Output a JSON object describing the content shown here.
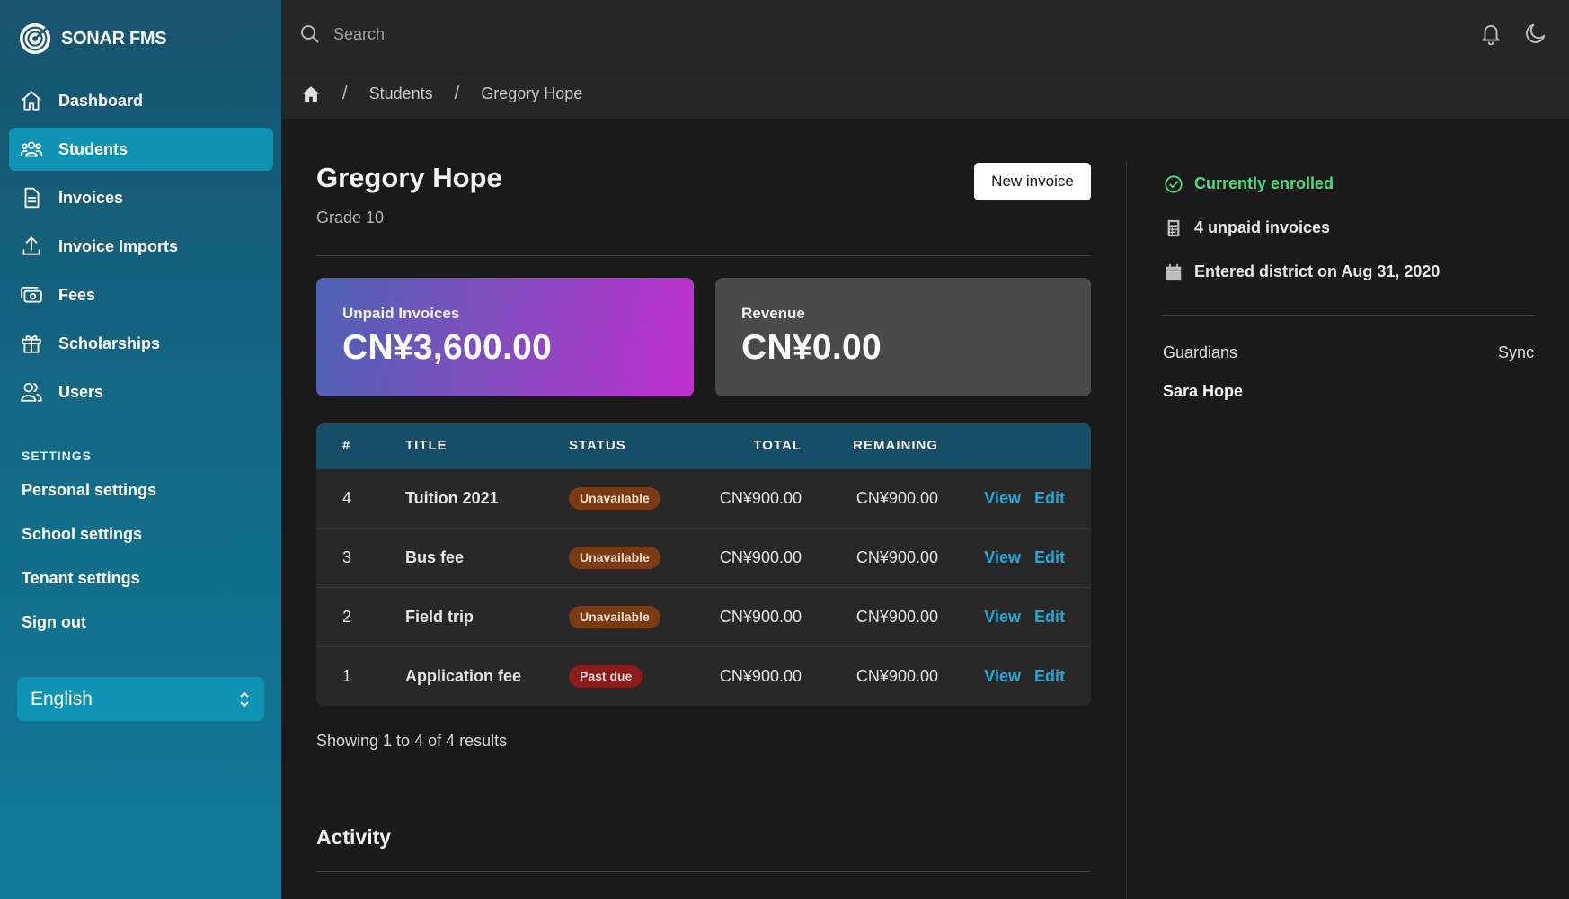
{
  "brand": {
    "name": "SONAR FMS"
  },
  "nav": [
    {
      "label": "Dashboard",
      "icon": "home-icon",
      "active": false
    },
    {
      "label": "Students",
      "icon": "users-icon",
      "active": true
    },
    {
      "label": "Invoices",
      "icon": "document-icon",
      "active": false
    },
    {
      "label": "Invoice Imports",
      "icon": "upload-icon",
      "active": false
    },
    {
      "label": "Fees",
      "icon": "cash-icon",
      "active": false
    },
    {
      "label": "Scholarships",
      "icon": "gift-icon",
      "active": false
    },
    {
      "label": "Users",
      "icon": "user-group-icon",
      "active": false
    }
  ],
  "settings": {
    "heading": "SETTINGS",
    "links": [
      "Personal settings",
      "School settings",
      "Tenant settings",
      "Sign out"
    ]
  },
  "language": {
    "selected": "English"
  },
  "search": {
    "placeholder": "Search"
  },
  "breadcrumb": [
    "Students",
    "Gregory Hope"
  ],
  "student": {
    "name": "Gregory Hope",
    "grade": "Grade 10"
  },
  "actions": {
    "new_invoice": "New invoice"
  },
  "stats": {
    "unpaid": {
      "label": "Unpaid Invoices",
      "value": "CN¥3,600.00"
    },
    "revenue": {
      "label": "Revenue",
      "value": "CN¥0.00"
    }
  },
  "table": {
    "headers": [
      "#",
      "TITLE",
      "STATUS",
      "TOTAL",
      "REMAINING"
    ],
    "rows": [
      {
        "num": "4",
        "title": "Tuition 2021",
        "status": "Unavailable",
        "total": "CN¥900.00",
        "remaining": "CN¥900.00"
      },
      {
        "num": "3",
        "title": "Bus fee",
        "status": "Unavailable",
        "total": "CN¥900.00",
        "remaining": "CN¥900.00"
      },
      {
        "num": "2",
        "title": "Field trip",
        "status": "Unavailable",
        "total": "CN¥900.00",
        "remaining": "CN¥900.00"
      },
      {
        "num": "1",
        "title": "Application fee",
        "status": "Past due",
        "total": "CN¥900.00",
        "remaining": "CN¥900.00"
      }
    ],
    "view_label": "View",
    "edit_label": "Edit",
    "results": "Showing 1 to 4 of 4 results"
  },
  "activity": {
    "title": "Activity"
  },
  "aside": {
    "enrolled": "Currently enrolled",
    "unpaid_invoices": "4 unpaid invoices",
    "entered_district": "Entered district on Aug 31, 2020",
    "guardians_heading": "Guardians",
    "sync_label": "Sync",
    "guardians": [
      "Sara Hope"
    ]
  },
  "colors": {
    "sidebar": "#136a86",
    "active_nav": "#0f93b5",
    "link": "#25a6d3",
    "enrolled": "#4ade80",
    "badge_unavailable": "#7a3a12",
    "badge_past_due": "#8a1c1c"
  }
}
